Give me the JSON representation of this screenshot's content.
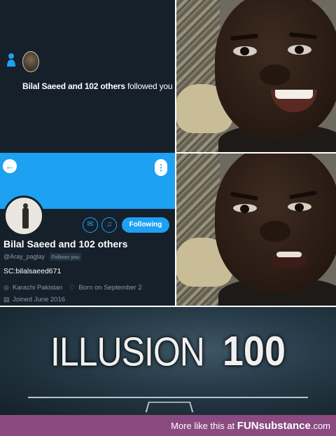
{
  "notification": {
    "actor": "Bilal Saeed and 102 others",
    "action": "followed you"
  },
  "profile": {
    "back_icon": "←",
    "more_icon": "⋮",
    "mail_icon": "✉",
    "bell_icon": "♫",
    "follow_button_label": "Following",
    "display_name": "Bilal Saeed and 102 others",
    "handle": "@Aray_paglay",
    "follows_you": "Follows you",
    "bio": "SC:bilalsaeed671",
    "location": "Karachi Pakistan",
    "birthday": "Born on September 2",
    "joined": "Joined June 2016",
    "accent_color": "#1da1f2",
    "background_color": "#15202b"
  },
  "skill_banner": {
    "skill_name": "ILLUSION",
    "skill_level": "100"
  },
  "footer": {
    "prefix": "More like this at",
    "brand": "FUNsubstance",
    "suffix": ".com",
    "color": "#8b4a80"
  }
}
